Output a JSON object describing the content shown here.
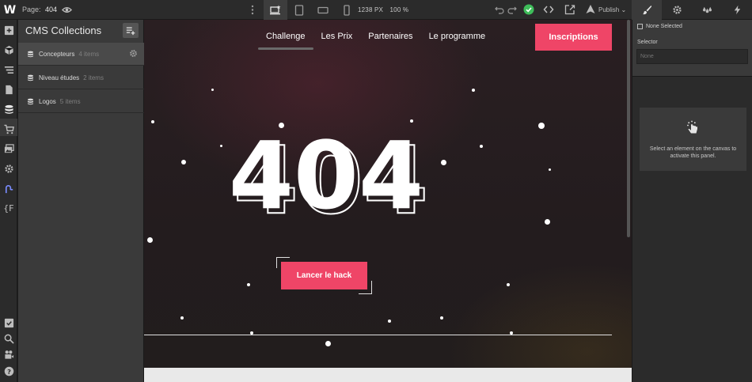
{
  "topbar": {
    "logo": "W",
    "page_label": "Page:",
    "page_value": "404",
    "size_px": "1238 PX",
    "zoom": "100 %",
    "publish_label": "Publish"
  },
  "cms": {
    "title": "CMS Collections",
    "items": [
      {
        "name": "Concepteurs",
        "count": "4 items"
      },
      {
        "name": "Niveau études",
        "count": "2 items"
      },
      {
        "name": "Logos",
        "count": "5 items"
      }
    ]
  },
  "canvas": {
    "nav": [
      "Challenge",
      "Les Prix",
      "Partenaires",
      "Le programme"
    ],
    "cta_label": "Inscriptions",
    "big_text": "404",
    "hack_label": "Lancer le hack"
  },
  "right_panel": {
    "none_selected": "None Selected",
    "selector_label": "Selector",
    "selector_placeholder": "None",
    "empty_message": "Select an element on the canvas to activate this panel."
  },
  "colors": {
    "accent_pink": "#ef4567",
    "success_green": "#3ebd5a",
    "style_icon_blue": "#7a8cff"
  }
}
